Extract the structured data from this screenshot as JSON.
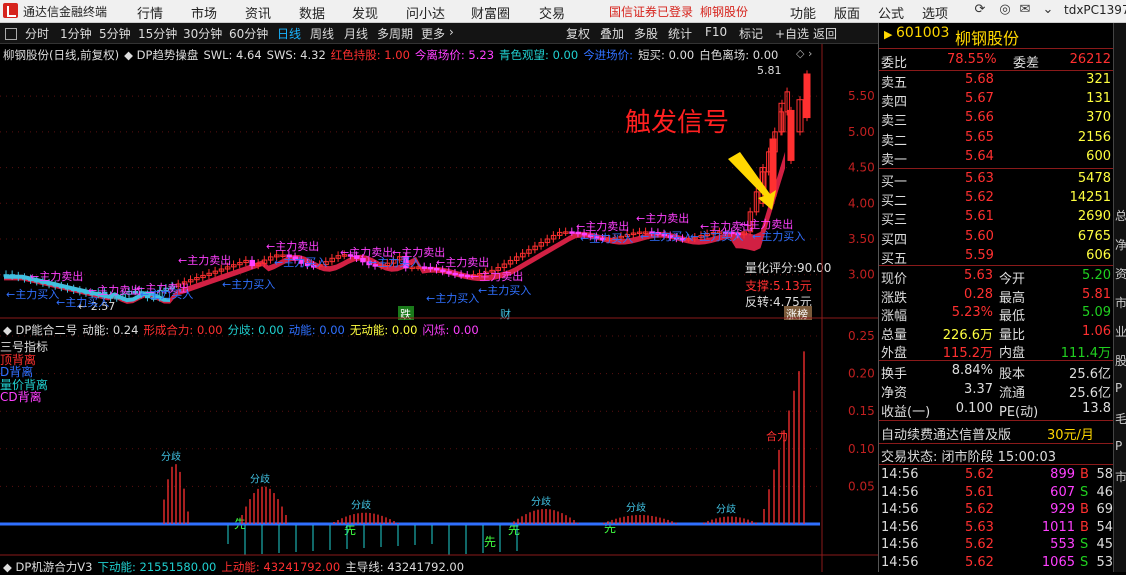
{
  "app": {
    "title": "通达信金融终端",
    "menu": [
      "行情",
      "市场",
      "资讯",
      "数据",
      "发现",
      "问小达",
      "财富圈",
      "交易"
    ],
    "broker_status": "国信证券已登录",
    "broker_stock": "柳钢股份",
    "right_menu": [
      "功能",
      "版面",
      "公式",
      "选项"
    ],
    "user": "tdxPC1397"
  },
  "toolbar": {
    "periods": [
      "分时",
      "1分钟",
      "5分钟",
      "15分钟",
      "30分钟",
      "60分钟",
      "日线",
      "周线",
      "月线",
      "多周期",
      "更多"
    ],
    "active_period": "日线",
    "tools": [
      "复权",
      "叠加",
      "多股",
      "统计",
      "F10",
      "标记",
      "+自选",
      "返回"
    ]
  },
  "main_chart": {
    "info": [
      {
        "text": "柳钢股份(日线,前复权)",
        "color": "#dddddd"
      },
      {
        "text": "◆ DP趋势操盘",
        "color": "#dddddd"
      },
      {
        "text": "SWL: 4.64",
        "color": "#dddddd"
      },
      {
        "text": "SWS: 4.32",
        "color": "#dddddd"
      },
      {
        "text": "红色持股: 1.00",
        "color": "#ff3030"
      },
      {
        "text": "今离场价: 5.23",
        "color": "#ff40ff"
      },
      {
        "text": "青色观望: 0.00",
        "color": "#20d0d0"
      },
      {
        "text": "今进场价:",
        "color": "#3070ff"
      },
      {
        "text": "短买: 0.00",
        "color": "#dddddd"
      },
      {
        "text": "白色离场: 0.00",
        "color": "#dddddd"
      }
    ],
    "annotation": "触发信号",
    "high_label": "5.81",
    "low_label": "2.57",
    "y_ticks": [
      "5.50",
      "5.00",
      "4.50",
      "4.00",
      "3.50",
      "3.00"
    ],
    "score": "量化评分:90.00",
    "support": "支撑:5.13元",
    "reversal": "反转:4.75元",
    "tag_limit_up": "涨榜",
    "tag_drop": "跌",
    "tag_finance": "财",
    "main_sell": "主力卖出",
    "main_buy": "主力买入"
  },
  "sub_chart": {
    "info": [
      {
        "text": "◆ DP能合二号",
        "color": "#dddddd"
      },
      {
        "text": "动能: 0.24",
        "color": "#dddddd"
      },
      {
        "text": "形成合力: 0.00",
        "color": "#ff3030"
      },
      {
        "text": "分歧: 0.00",
        "color": "#20d0d0"
      },
      {
        "text": "动能: 0.00",
        "color": "#3070ff"
      },
      {
        "text": "无动能: 0.00",
        "color": "#ffff40"
      },
      {
        "text": "闪烁: 0.00",
        "color": "#ff40ff"
      }
    ],
    "legend": [
      {
        "text": "三号指标",
        "color": "#dddddd"
      },
      {
        "text": "顶背离",
        "color": "#ff3030"
      },
      {
        "text": "D背离",
        "color": "#3070ff"
      },
      {
        "text": "量价背离",
        "color": "#20d0d0"
      },
      {
        "text": "CD背离",
        "color": "#ff40ff"
      }
    ],
    "y_ticks": [
      "0.25",
      "0.20",
      "0.15",
      "0.10",
      "0.05"
    ],
    "label_divergence": "分歧",
    "label_first": "先",
    "label_force": "合力"
  },
  "bottom_info": [
    {
      "text": "◆ DP机游合力V3",
      "color": "#dddddd"
    },
    {
      "text": "下动能: 21551580.00",
      "color": "#20d0d0"
    },
    {
      "text": "上动能: 43241792.00",
      "color": "#ff3030"
    },
    {
      "text": "主导线: 43241792.00",
      "color": "#dddddd"
    }
  ],
  "quote": {
    "code": "601003",
    "name": "柳钢股份",
    "weibi_label": "委比",
    "weibi": "78.55%",
    "weicha_label": "委差",
    "weicha": "26212",
    "sells": [
      {
        "label": "卖五",
        "price": "5.68",
        "vol": "321"
      },
      {
        "label": "卖四",
        "price": "5.67",
        "vol": "131"
      },
      {
        "label": "卖三",
        "price": "5.66",
        "vol": "370"
      },
      {
        "label": "卖二",
        "price": "5.65",
        "vol": "2156"
      },
      {
        "label": "卖一",
        "price": "5.64",
        "vol": "600"
      }
    ],
    "buys": [
      {
        "label": "买一",
        "price": "5.63",
        "vol": "5478"
      },
      {
        "label": "买二",
        "price": "5.62",
        "vol": "14251"
      },
      {
        "label": "买三",
        "price": "5.61",
        "vol": "2690"
      },
      {
        "label": "买四",
        "price": "5.60",
        "vol": "6765"
      },
      {
        "label": "买五",
        "price": "5.59",
        "vol": "606"
      }
    ],
    "stats": [
      {
        "l1": "现价",
        "v1": "5.63",
        "c1": "#ff3030",
        "l2": "今开",
        "v2": "5.20",
        "c2": "#20d020"
      },
      {
        "l1": "涨跌",
        "v1": "0.28",
        "c1": "#ff3030",
        "l2": "最高",
        "v2": "5.81",
        "c2": "#ff3030"
      },
      {
        "l1": "涨幅",
        "v1": "5.23%",
        "c1": "#ff3030",
        "l2": "最低",
        "v2": "5.09",
        "c2": "#20d020"
      },
      {
        "l1": "总量",
        "v1": "226.6万",
        "c1": "#ffff40",
        "l2": "量比",
        "v2": "1.06",
        "c2": "#ff3030"
      },
      {
        "l1": "外盘",
        "v1": "115.2万",
        "c1": "#ff3030",
        "l2": "内盘",
        "v2": "111.4万",
        "c2": "#20d020"
      }
    ],
    "stats2": [
      {
        "l1": "换手",
        "v1": "8.84%",
        "l2": "股本",
        "v2": "25.6亿"
      },
      {
        "l1": "净资",
        "v1": "3.37",
        "l2": "流通",
        "v2": "25.6亿"
      },
      {
        "l1": "收益(一)",
        "v1": "0.100",
        "l2": "PE(动)",
        "v2": "13.8"
      }
    ],
    "promo": "自动续费通达信普及版",
    "promo_price": "30元/月",
    "status": "交易状态: 闭市阶段 15:00:03",
    "ticks": [
      {
        "time": "14:56",
        "price": "5.62",
        "vol": "899",
        "side": "B",
        "n": "58"
      },
      {
        "time": "14:56",
        "price": "5.61",
        "vol": "607",
        "side": "S",
        "n": "46"
      },
      {
        "time": "14:56",
        "price": "5.62",
        "vol": "929",
        "side": "B",
        "n": "69"
      },
      {
        "time": "14:56",
        "price": "5.63",
        "vol": "1011",
        "side": "B",
        "n": "54"
      },
      {
        "time": "14:56",
        "price": "5.62",
        "vol": "553",
        "side": "S",
        "n": "45"
      },
      {
        "time": "14:56",
        "price": "5.62",
        "vol": "1065",
        "side": "S",
        "n": "53"
      }
    ],
    "side_strip": [
      "总",
      "净",
      "资",
      "市",
      "业",
      "股",
      "P",
      "毛",
      "P",
      "市"
    ]
  }
}
